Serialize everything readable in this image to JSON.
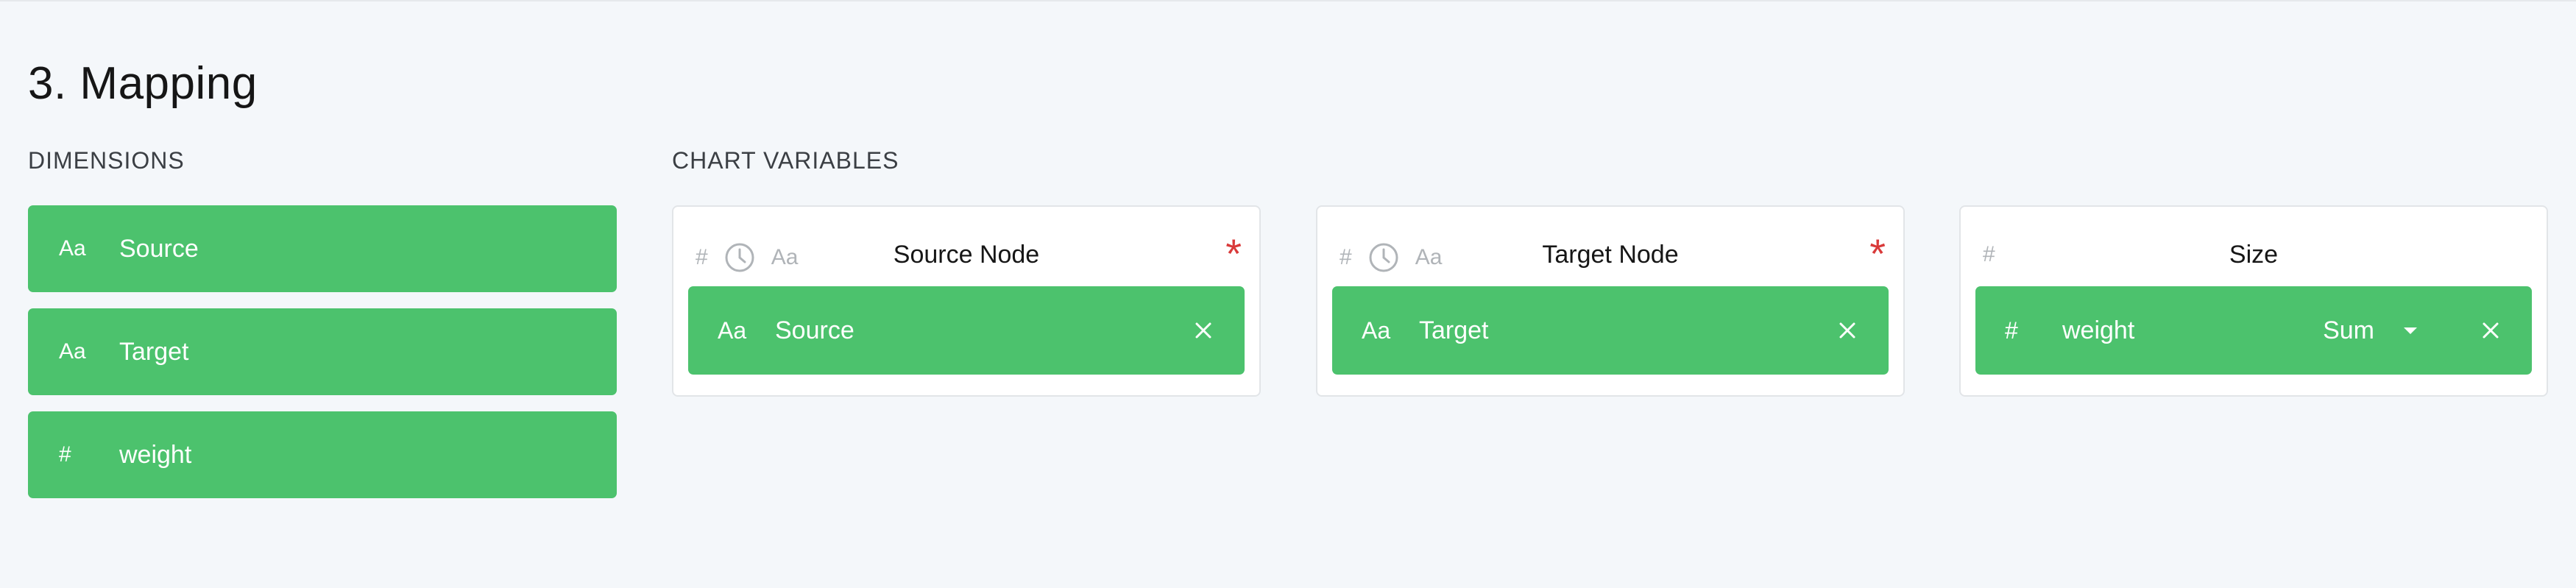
{
  "section": {
    "title": "3. Mapping"
  },
  "dimensions": {
    "heading": "DIMENSIONS",
    "items": [
      {
        "type_icon": "Aa",
        "label": "Source"
      },
      {
        "type_icon": "Aa",
        "label": "Target"
      },
      {
        "type_icon": "#",
        "label": "weight"
      }
    ]
  },
  "chart_variables": {
    "heading": "CHART VARIABLES",
    "cards": [
      {
        "title": "Source Node",
        "accepted_type_icons": [
          "#",
          "clock-icon",
          "Aa"
        ],
        "required": "*",
        "mapped": {
          "type_icon": "Aa",
          "label": "Source"
        }
      },
      {
        "title": "Target Node",
        "accepted_type_icons": [
          "#",
          "clock-icon",
          "Aa"
        ],
        "required": "*",
        "mapped": {
          "type_icon": "Aa",
          "label": "Target"
        }
      },
      {
        "title": "Size",
        "accepted_type_icons": [
          "#"
        ],
        "mapped": {
          "type_icon": "#",
          "label": "weight",
          "aggregation": "Sum"
        }
      }
    ]
  },
  "colors": {
    "background": "#f4f7fa",
    "dimension_green": "#4cc26d",
    "required_red": "#d93a3a",
    "muted_icon": "#b0b4b8"
  }
}
